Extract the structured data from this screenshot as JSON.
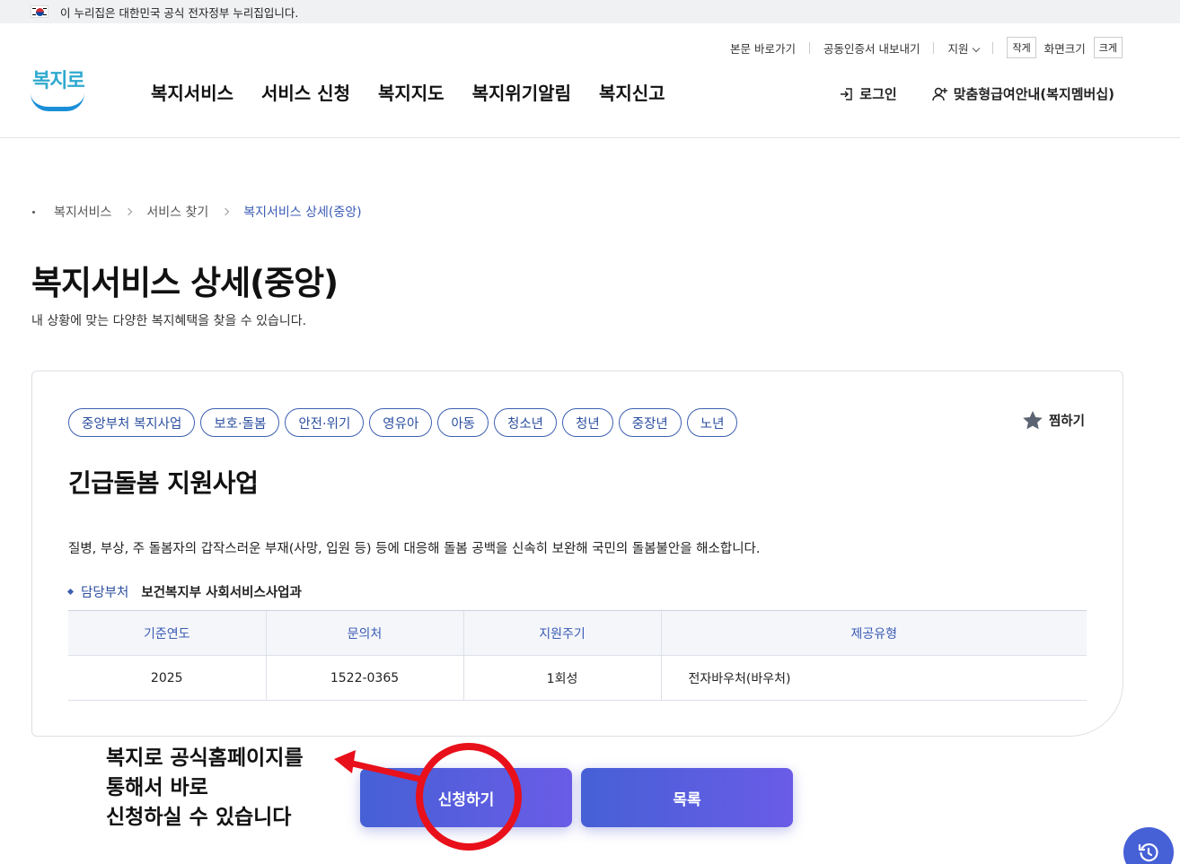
{
  "gov_banner": {
    "text": "이 누리집은 대한민국 공식 전자정부 누리집입니다."
  },
  "util_nav": {
    "skip_link": "본문 바로가기",
    "cert_export": "공동인증서 내보내기",
    "support": "지원",
    "font_small": "작게",
    "zoom_label": "화면크기",
    "font_large": "크게"
  },
  "logo": {
    "text": "복지로"
  },
  "gnb": [
    "복지서비스",
    "서비스 신청",
    "복지지도",
    "복지위기알림",
    "복지신고"
  ],
  "member": {
    "login": "로그인",
    "membership": "맞춤형급여안내(복지멤버십)"
  },
  "breadcrumb": [
    "복지서비스",
    "서비스 찾기",
    "복지서비스 상세(중앙)"
  ],
  "page": {
    "title": "복지서비스 상세(중앙)",
    "description": "내 상황에 맞는 다양한 복지혜택을 찾을 수 있습니다."
  },
  "service": {
    "tags": [
      "중앙부처 복지사업",
      "보호·돌봄",
      "안전·위기",
      "영유아",
      "아동",
      "청소년",
      "청년",
      "중장년",
      "노년"
    ],
    "favorite_label": "찜하기",
    "title": "긴급돌봄 지원사업",
    "description": "질병, 부상, 주 돌봄자의 갑작스러운 부재(사망, 입원 등) 등에 대응해 돌봄 공백을 신속히 보완해 국민의 돌봄불안을 해소합니다.",
    "dept_label": "담당부처",
    "dept_value": "보건복지부 사회서비스사업과",
    "table": {
      "headers": [
        "기준연도",
        "문의처",
        "지원주기",
        "제공유형"
      ],
      "row": [
        "2025",
        "1522-0365",
        "1회성",
        "전자바우처(바우처)"
      ]
    }
  },
  "actions": {
    "apply": "신청하기",
    "list": "목록"
  },
  "annotation": {
    "text": "복지로 공식홈페이지를\n통해서 바로\n신청하실 수 있습니다"
  },
  "colors": {
    "brand_blue": "#3c5fb0",
    "button_gradient_start": "#4660d6",
    "button_gradient_end": "#6a5ce6",
    "annotation_red": "#e8101a"
  },
  "icons": [
    "taegeuk-flag-icon",
    "chevron-down-icon",
    "login-icon",
    "user-plus-icon",
    "star-icon",
    "refresh-icon"
  ]
}
